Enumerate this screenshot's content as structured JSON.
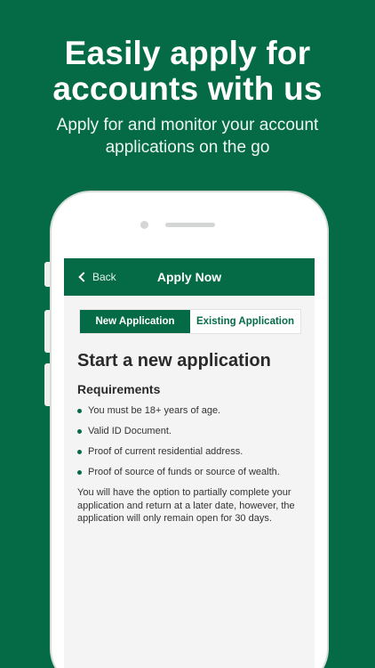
{
  "hero": {
    "title_line1": "Easily apply for",
    "title_line2": "accounts with us",
    "subtitle_line1": "Apply for and monitor your account",
    "subtitle_line2": "applications on the go"
  },
  "navbar": {
    "back_label": "Back",
    "title": "Apply Now"
  },
  "tabs": [
    {
      "label": "New Application",
      "active": true
    },
    {
      "label": "Existing Application",
      "active": false
    }
  ],
  "main": {
    "heading": "Start a new application",
    "requirements_heading": "Requirements",
    "requirements": [
      "You must be 18+ years of age.",
      "Valid ID Document.",
      "Proof of current residential address.",
      "Proof of source of funds or source of wealth."
    ],
    "note": "You will have the option to partially complete your application and return at a later date, however, the application will only remain open for 30 days."
  },
  "colors": {
    "brand": "#056b46",
    "screen_bg": "#f4f4f4"
  },
  "icons": {
    "back": "chevron-left-icon"
  }
}
